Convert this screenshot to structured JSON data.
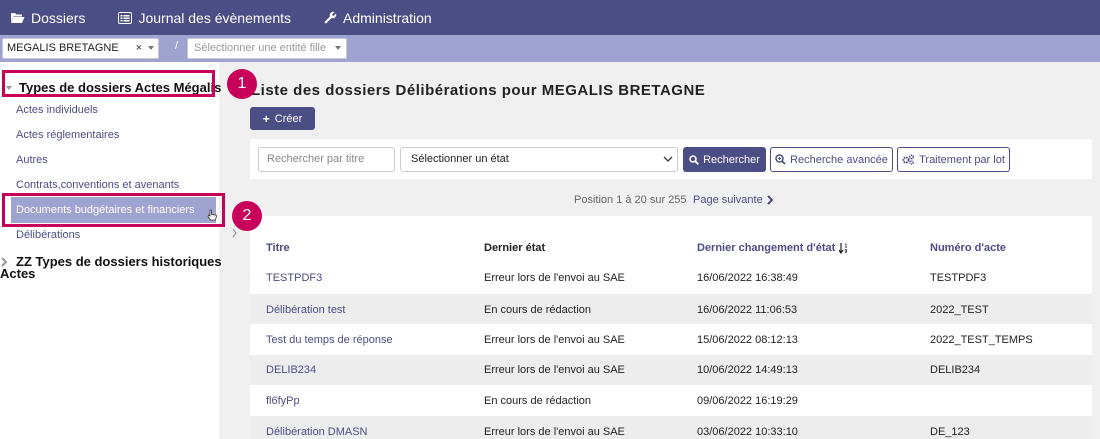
{
  "topnav": {
    "dossiers": "Dossiers",
    "journal": "Journal des évènements",
    "administration": "Administration"
  },
  "subbar": {
    "entity_value": "MEGALIS BRETAGNE",
    "entity_clear": "×",
    "separator": "/",
    "child_placeholder": "Sélectionner une entité fille"
  },
  "sidebar": {
    "section1_title": "Types de dossiers Actes Mégalis",
    "items": [
      {
        "label": "Actes individuels"
      },
      {
        "label": "Actes réglementaires"
      },
      {
        "label": "Autres"
      },
      {
        "label": "Contrats,conventions et avenants"
      },
      {
        "label": "Documents budgétaires et financiers"
      },
      {
        "label": "Délibérations"
      }
    ],
    "section2_line1": "ZZ Types de dossiers historiques",
    "section2_line2": "Actes"
  },
  "annotations": {
    "badge1": "1",
    "badge2": "2",
    "highlight_color": "#c8005a"
  },
  "main": {
    "title": "Liste des dossiers Délibérations pour MEGALIS BRETAGNE",
    "create_label": "Créer",
    "search_placeholder": "Rechercher par titre",
    "state_select": "Sélectionner un état",
    "search_button": "Rechercher",
    "advanced_button": "Recherche avancée",
    "batch_button": "Traitement par lot",
    "pager_position": "Position 1 à 20 sur 255",
    "pager_next": "Page suivante"
  },
  "table": {
    "headers": {
      "titre": "Titre",
      "etat": "Dernier état",
      "date": "Dernier changement d'état",
      "numero": "Numéro d'acte"
    },
    "rows": [
      {
        "titre": "TESTPDF3",
        "etat": "Erreur lors de l'envoi au SAE",
        "date": "16/06/2022 16:38:49",
        "numero": "TESTPDF3"
      },
      {
        "titre": "Délibération test",
        "etat": "En cours de rédaction",
        "date": "16/06/2022 11:06:53",
        "numero": "2022_TEST"
      },
      {
        "titre": "Test du temps de réponse",
        "etat": "Erreur lors de l'envoi au SAE",
        "date": "15/06/2022 08:12:13",
        "numero": "2022_TEST_TEMPS"
      },
      {
        "titre": "DELIB234",
        "etat": "Erreur lors de l'envoi au SAE",
        "date": "10/06/2022 14:49:13",
        "numero": "DELIB234"
      },
      {
        "titre": "fl6fyPp",
        "etat": "En cours de rédaction",
        "date": "09/06/2022 16:19:29",
        "numero": ""
      },
      {
        "titre": "Délibération DMASN",
        "etat": "Erreur lors de l'envoi au SAE",
        "date": "03/06/2022 10:33:10",
        "numero": "DE_123"
      }
    ]
  },
  "colors": {
    "brand": "#4a4e85",
    "subbar": "#9ea3cf",
    "highlight": "#c8005a"
  }
}
